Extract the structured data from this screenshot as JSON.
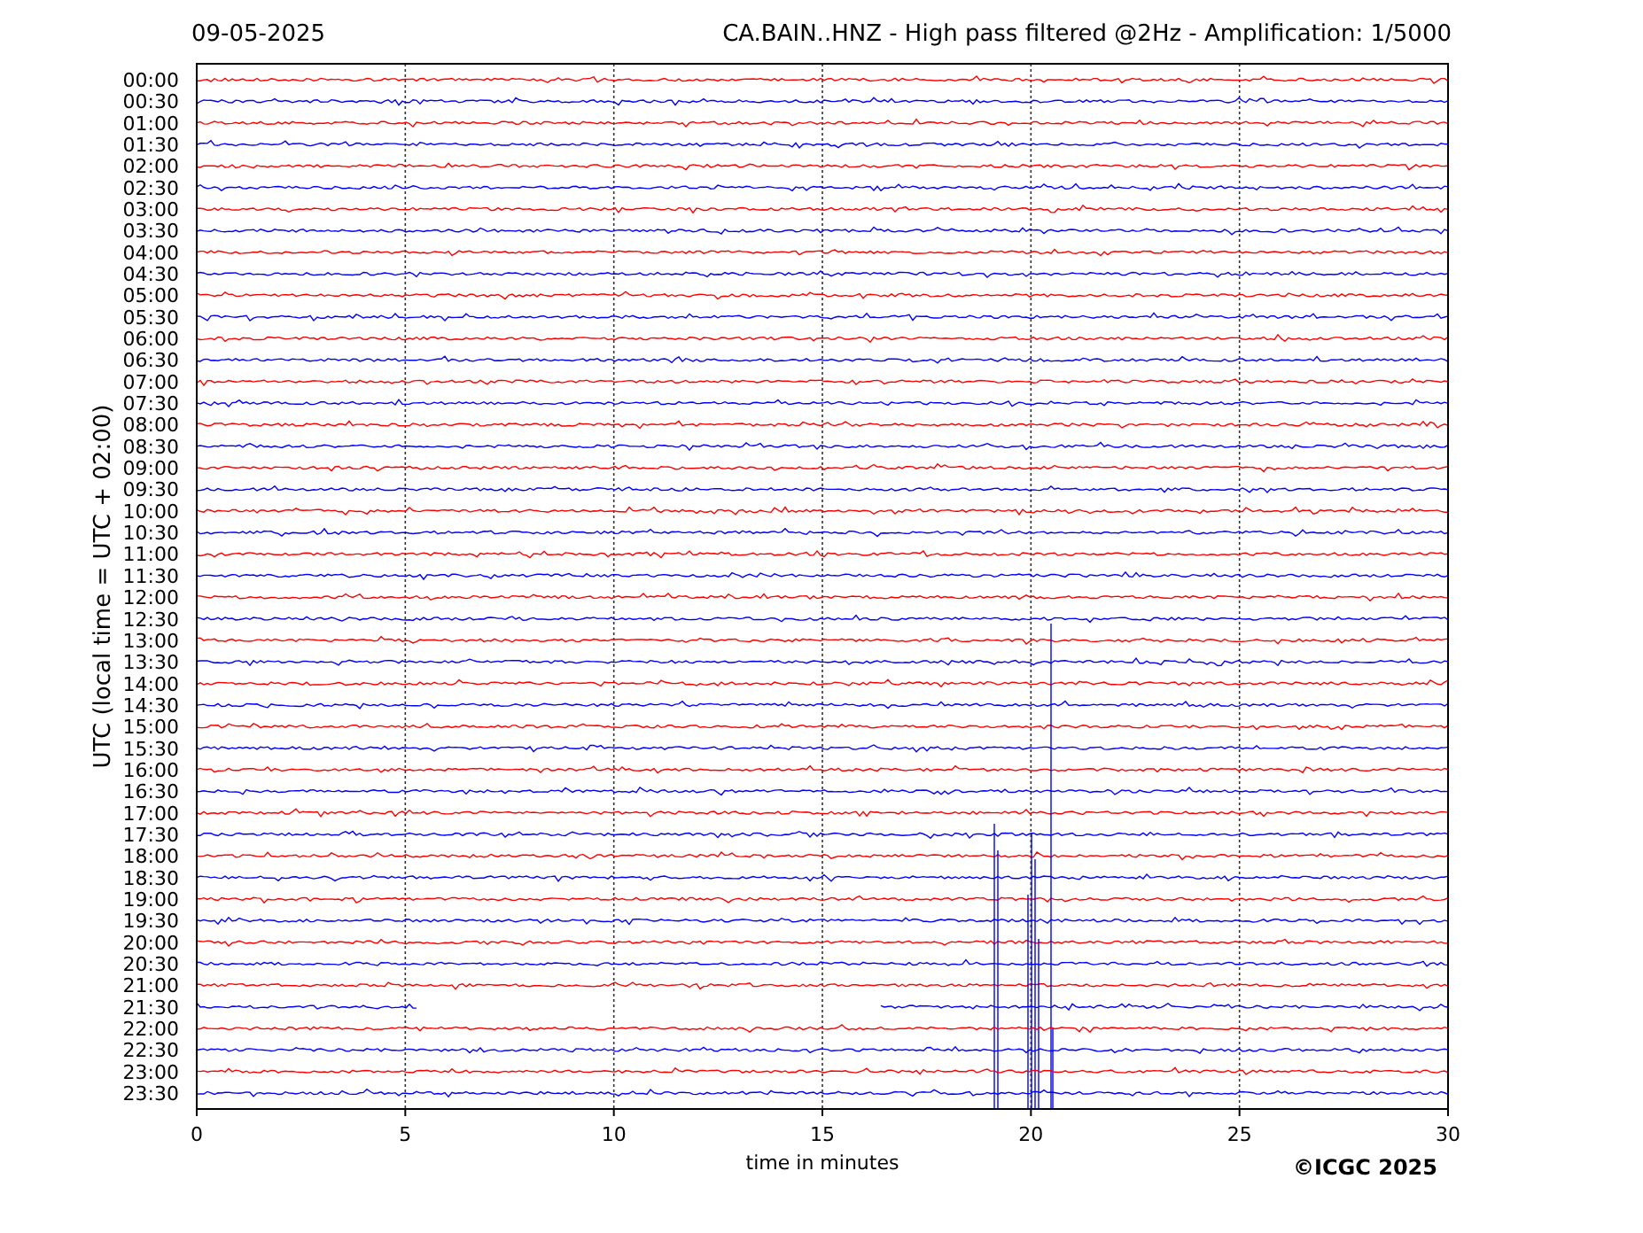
{
  "header": {
    "date": "09-05-2025",
    "title": "CA.BAIN..HNZ - High pass filtered @2Hz - Amplification: 1/5000"
  },
  "y_axis": {
    "label": "UTC (local time = UTC + 02:00)"
  },
  "rows": [
    {
      "label": "00:00",
      "color": "#ff0000"
    },
    {
      "label": "00:30",
      "color": "#0000ff"
    },
    {
      "label": "01:00",
      "color": "#ff0000"
    },
    {
      "label": "01:30",
      "color": "#0000ff"
    },
    {
      "label": "02:00",
      "color": "#ff0000"
    },
    {
      "label": "02:30",
      "color": "#0000ff"
    },
    {
      "label": "03:00",
      "color": "#ff0000"
    },
    {
      "label": "03:30",
      "color": "#0000ff"
    },
    {
      "label": "04:00",
      "color": "#ff0000"
    },
    {
      "label": "04:30",
      "color": "#0000ff"
    },
    {
      "label": "05:00",
      "color": "#ff0000"
    },
    {
      "label": "05:30",
      "color": "#0000ff"
    },
    {
      "label": "06:00",
      "color": "#ff0000"
    },
    {
      "label": "06:30",
      "color": "#0000ff"
    },
    {
      "label": "07:00",
      "color": "#ff0000"
    },
    {
      "label": "07:30",
      "color": "#0000ff"
    },
    {
      "label": "08:00",
      "color": "#ff0000"
    },
    {
      "label": "08:30",
      "color": "#0000ff"
    },
    {
      "label": "09:00",
      "color": "#ff0000"
    },
    {
      "label": "09:30",
      "color": "#0000ff"
    },
    {
      "label": "10:00",
      "color": "#ff0000"
    },
    {
      "label": "10:30",
      "color": "#0000ff"
    },
    {
      "label": "11:00",
      "color": "#ff0000"
    },
    {
      "label": "11:30",
      "color": "#0000ff"
    },
    {
      "label": "12:00",
      "color": "#ff0000"
    },
    {
      "label": "12:30",
      "color": "#0000ff"
    },
    {
      "label": "13:00",
      "color": "#ff0000"
    },
    {
      "label": "13:30",
      "color": "#0000ff"
    },
    {
      "label": "14:00",
      "color": "#ff0000"
    },
    {
      "label": "14:30",
      "color": "#0000ff"
    },
    {
      "label": "15:00",
      "color": "#ff0000"
    },
    {
      "label": "15:30",
      "color": "#0000ff"
    },
    {
      "label": "16:00",
      "color": "#ff0000"
    },
    {
      "label": "16:30",
      "color": "#0000ff"
    },
    {
      "label": "17:00",
      "color": "#ff0000"
    },
    {
      "label": "17:30",
      "color": "#0000ff"
    },
    {
      "label": "18:00",
      "color": "#ff0000"
    },
    {
      "label": "18:30",
      "color": "#0000ff"
    },
    {
      "label": "19:00",
      "color": "#ff0000"
    },
    {
      "label": "19:30",
      "color": "#0000ff"
    },
    {
      "label": "20:00",
      "color": "#ff0000"
    },
    {
      "label": "20:30",
      "color": "#0000ff"
    },
    {
      "label": "21:00",
      "color": "#ff0000"
    },
    {
      "label": "21:30",
      "color": "#0000ff"
    },
    {
      "label": "22:00",
      "color": "#ff0000"
    },
    {
      "label": "22:30",
      "color": "#0000ff"
    },
    {
      "label": "23:00",
      "color": "#ff0000"
    },
    {
      "label": "23:30",
      "color": "#0000ff"
    }
  ],
  "x_axis": {
    "label": "time in minutes",
    "ticks": [
      "0",
      "5",
      "10",
      "15",
      "20",
      "25",
      "30"
    ]
  },
  "copyright": "©ICGC 2025"
}
